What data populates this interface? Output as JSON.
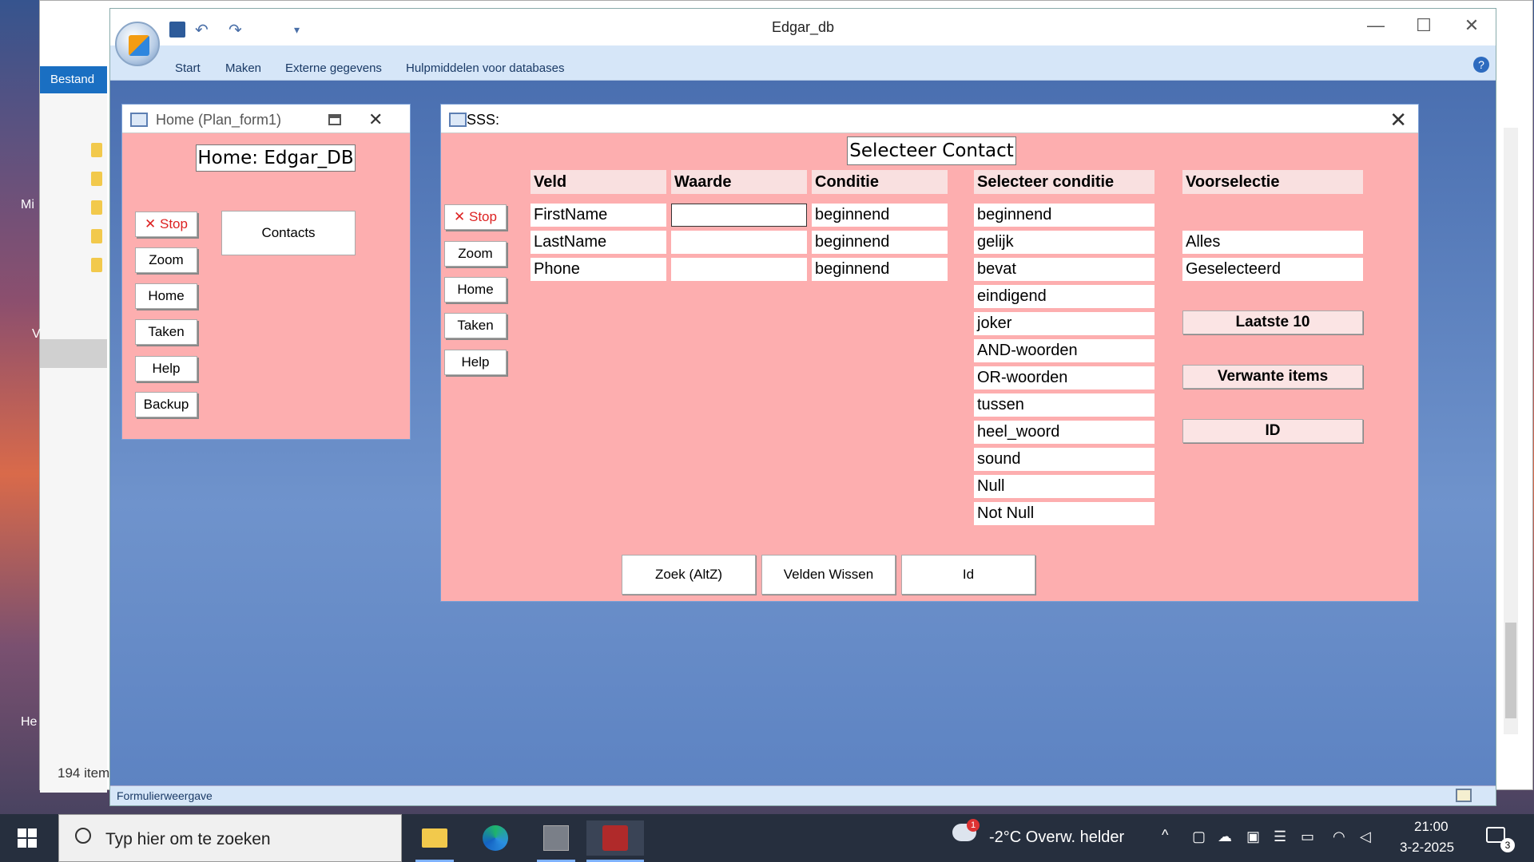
{
  "explorer": {
    "ribbon_tab": "Bestand",
    "item_count": "194 item",
    "side_texts": [
      "Mi",
      "V",
      "He"
    ]
  },
  "access": {
    "title": "Edgar_db",
    "menu": [
      "Start",
      "Maken",
      "Externe gegevens",
      "Hulpmiddelen voor databases"
    ],
    "status": "Formulierweergave"
  },
  "home_form": {
    "title": "Home (Plan_form1)",
    "header": "Home: Edgar_DB",
    "buttons": [
      "✕ Stop",
      "Zoom",
      "Home",
      "Taken",
      "Help",
      "Backup"
    ],
    "contacts": "Contacts"
  },
  "sss_form": {
    "title": "SSS:",
    "header": "Selecteer Contact",
    "side_buttons": [
      "✕ Stop",
      "Zoom",
      "Home",
      "Taken",
      "Help"
    ],
    "col_headers": {
      "veld": "Veld",
      "waarde": "Waarde",
      "conditie": "Conditie",
      "selecteer": "Selecteer conditie",
      "voorselectie": "Voorselectie"
    },
    "rows": [
      {
        "veld": "FirstName",
        "waarde": "",
        "conditie": "beginnend"
      },
      {
        "veld": "LastName",
        "waarde": "",
        "conditie": "beginnend"
      },
      {
        "veld": "Phone",
        "waarde": "",
        "conditie": "beginnend"
      }
    ],
    "conditions": [
      "beginnend",
      "gelijk",
      "bevat",
      "eindigend",
      "joker",
      "AND-woorden",
      "OR-woorden",
      "tussen",
      "heel_woord",
      "sound",
      "Null",
      "Not Null"
    ],
    "preselect": [
      "Alles",
      "Geselecteerd"
    ],
    "right_buttons": [
      "Laatste 10",
      "Verwante items",
      "ID"
    ],
    "bottom_buttons": [
      "Zoek (AltZ)",
      "Velden Wissen",
      "Id"
    ]
  },
  "taskbar": {
    "search_placeholder": "Typ hier om te zoeken",
    "weather": "-2°C  Overw. helder",
    "weather_badge": "1",
    "time": "21:00",
    "date": "3-2-2025",
    "notif_count": "3"
  }
}
